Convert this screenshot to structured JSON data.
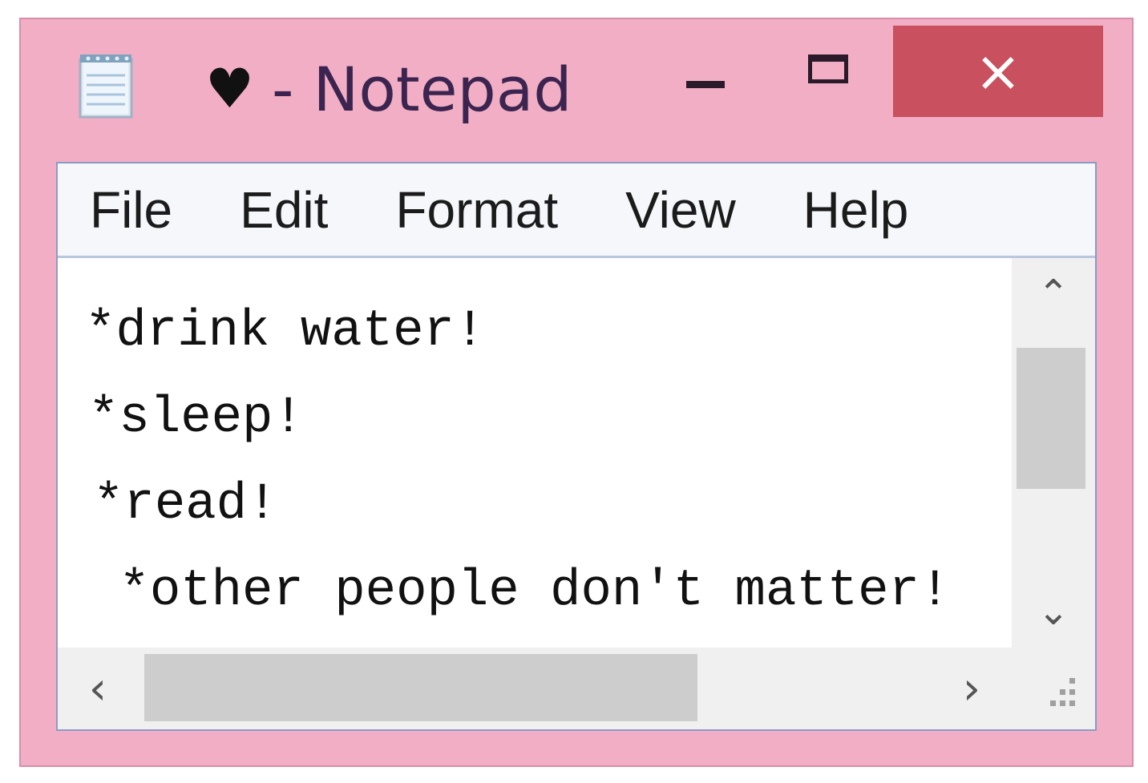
{
  "window": {
    "title_icon": "heart-icon",
    "title_heart": "♥",
    "title_text": "- Notepad",
    "close_glyph": "×",
    "close_color": "#c9505e",
    "frame_color": "#f2aec4"
  },
  "menu": {
    "items": [
      {
        "label": "File"
      },
      {
        "label": "Edit"
      },
      {
        "label": "Format"
      },
      {
        "label": "View"
      },
      {
        "label": "Help"
      }
    ]
  },
  "editor": {
    "lines": [
      "*drink water!",
      "*sleep!",
      "*read!",
      " *other people don't matter!"
    ]
  },
  "scrollbars": {
    "up_glyph": "⌃",
    "down_glyph": "⌄",
    "left_glyph": "‹",
    "right_glyph": "›"
  }
}
